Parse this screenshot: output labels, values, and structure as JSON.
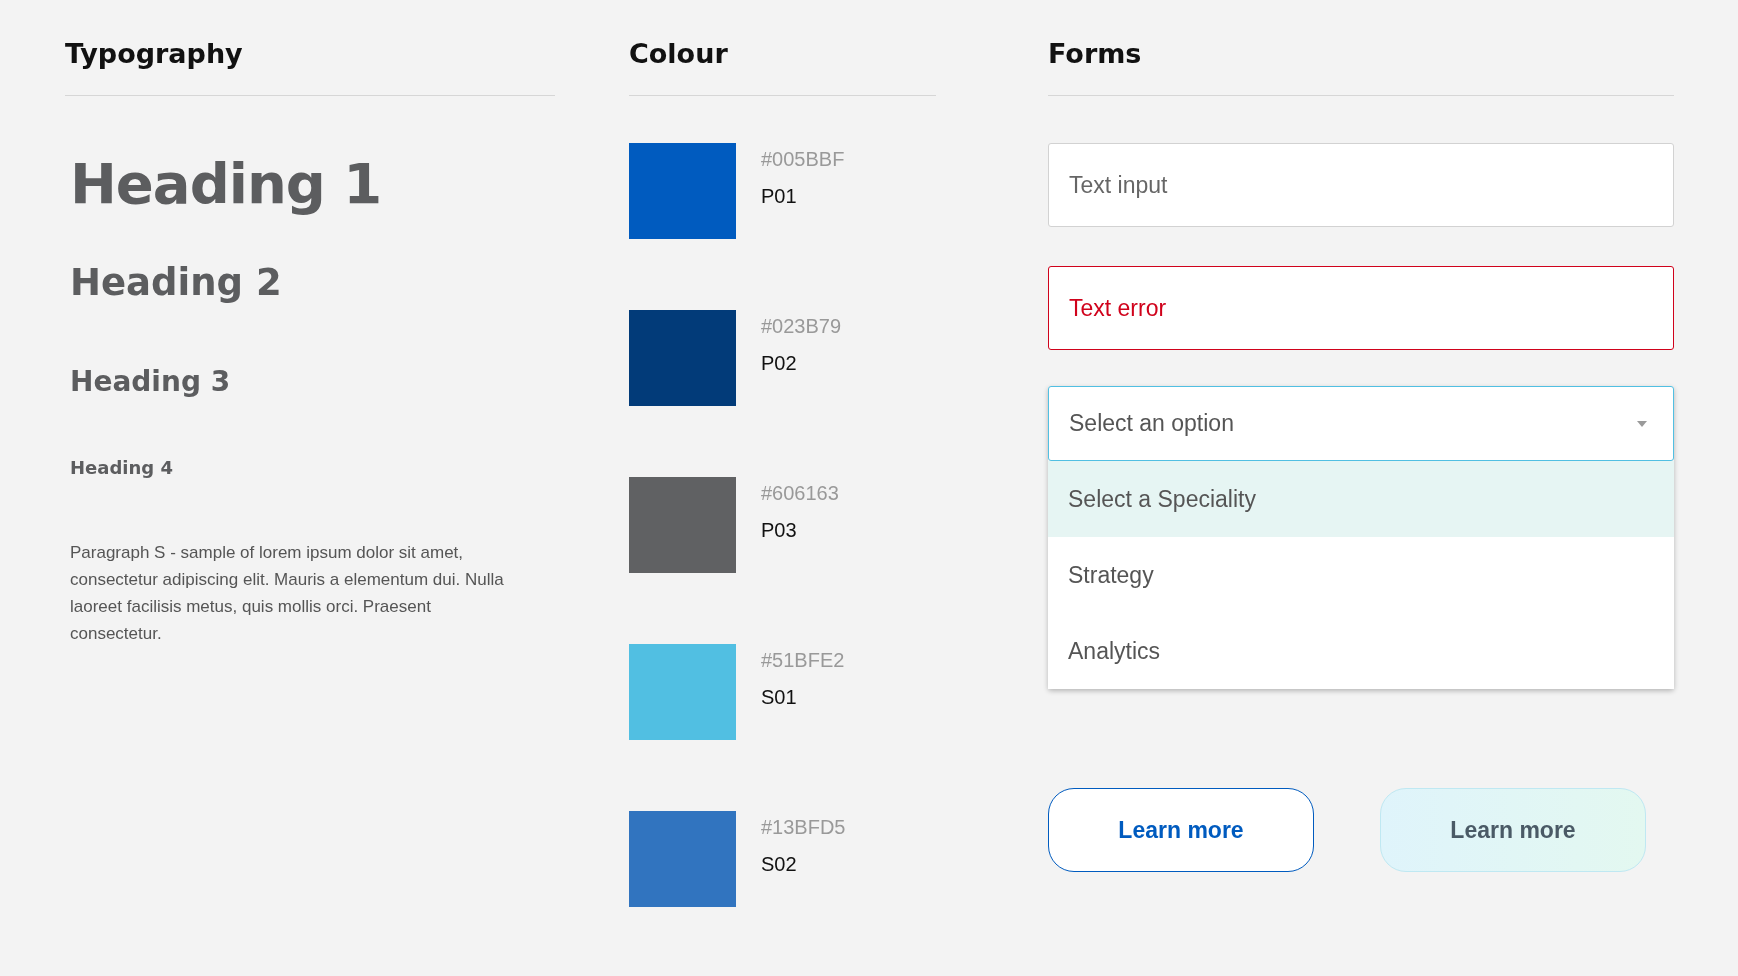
{
  "typography": {
    "title": "Typography",
    "headings": [
      {
        "kind": "h1",
        "text": "Heading 1"
      },
      {
        "kind": "h2",
        "text": "Heading 2"
      },
      {
        "kind": "h3",
        "text": "Heading 3"
      },
      {
        "kind": "h4",
        "text": "Heading 4"
      }
    ],
    "paragraph": "Paragraph S -  sample of lorem ipsum dolor sit amet, consectetur adipiscing elit. Mauris a elementum dui. Nulla laoreet facilisis metus, quis mollis orci. Praesent consectetur."
  },
  "colour": {
    "title": "Colour",
    "swatches": [
      {
        "hex": "#005BBF",
        "code": "P01",
        "color": "#005bbf"
      },
      {
        "hex": "#023B79",
        "code": "P02",
        "color": "#023b79"
      },
      {
        "hex": "#606163",
        "code": "P03",
        "color": "#606163"
      },
      {
        "hex": "#51BFE2",
        "code": "S01",
        "color": "#51bfe2"
      },
      {
        "hex": "#13BFD5",
        "code": "S02",
        "color": "#3174bf"
      }
    ]
  },
  "forms": {
    "title": "Forms",
    "text_input": {
      "placeholder": "Text input"
    },
    "error_input": {
      "value": "Text error"
    },
    "select": {
      "placeholder": "Select an option",
      "expanded": true,
      "options": [
        {
          "label": "Select a Speciality",
          "selected": true
        },
        {
          "label": "Strategy",
          "selected": false
        },
        {
          "label": "Analytics",
          "selected": false
        }
      ]
    },
    "buttons": [
      {
        "kind": "outline",
        "label": "Learn more"
      },
      {
        "kind": "soft",
        "label": "Learn more"
      }
    ]
  }
}
